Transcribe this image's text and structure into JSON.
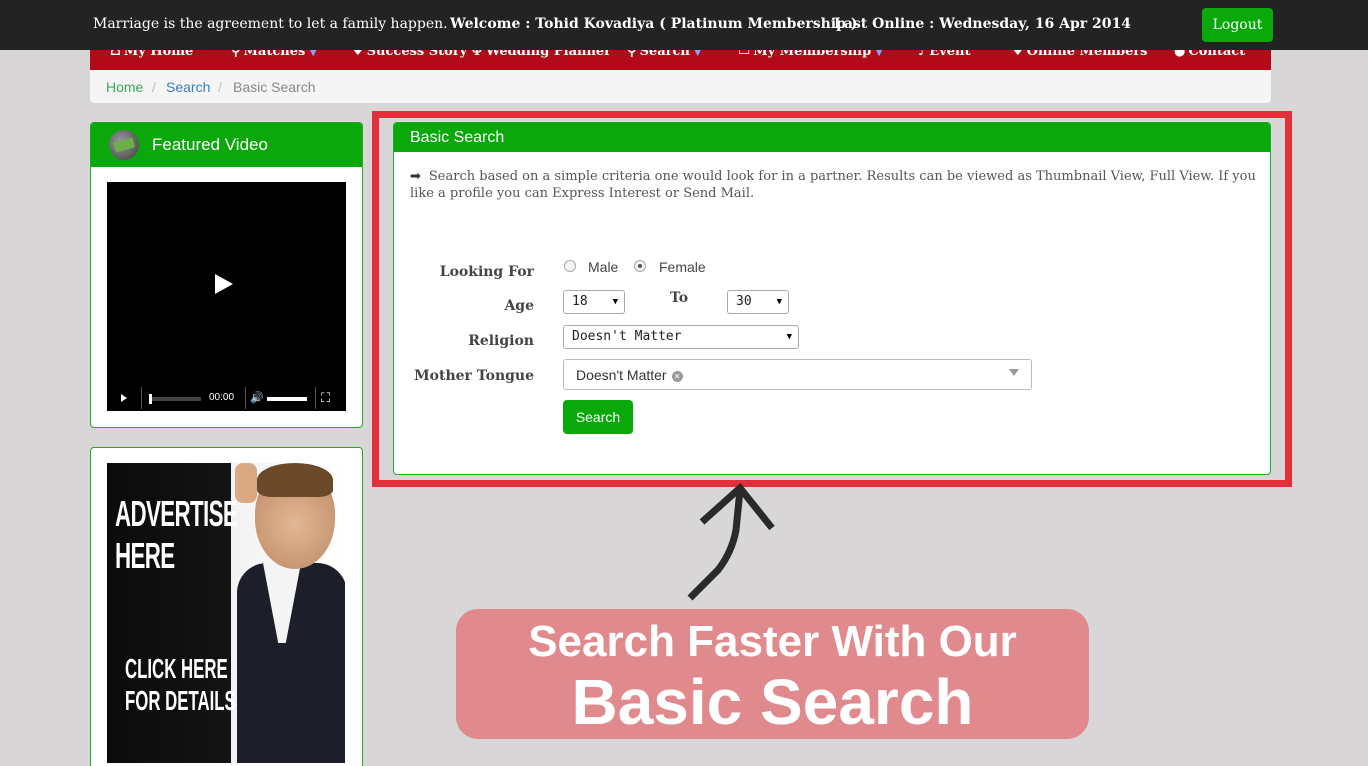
{
  "topbar": {
    "tagline": "Marriage is the agreement to let a family happen.",
    "welcome": "Welcome : Tohid Kovadiya ( Platinum Membership )",
    "last_online": "Last Online : Wednesday, 16 Apr 2014",
    "logout": "Logout"
  },
  "nav": {
    "items": [
      {
        "label": "My Home",
        "icon": "home-icon"
      },
      {
        "label": "Matches",
        "icon": "search-icon"
      },
      {
        "label": "Success Story",
        "icon": "heart-icon"
      },
      {
        "label": "Wedding Planner",
        "icon": "fork-icon"
      },
      {
        "label": "Search",
        "icon": "search-icon"
      },
      {
        "label": "My Membership",
        "icon": "card-icon"
      },
      {
        "label": "Event",
        "icon": "bell-icon"
      },
      {
        "label": "Online Members",
        "icon": "heart-icon"
      },
      {
        "label": "Contact",
        "icon": "user-icon"
      }
    ]
  },
  "breadcrumb": {
    "home": "Home",
    "search": "Search",
    "current": "Basic Search",
    "separator": "/"
  },
  "video_panel": {
    "title": "Featured Video",
    "time": "00:00"
  },
  "ad": {
    "headline_1": "ADVERTISE",
    "headline_2": "HERE",
    "cta_1": "CLICK HERE",
    "cta_2": "FOR DETAILS"
  },
  "search_panel": {
    "title": "Basic Search",
    "description": "Search based on a simple criteria one would look for in a partner. Results can be viewed as Thumbnail View, Full View. If you like a profile you can Express Interest or Send Mail.",
    "labels": {
      "looking_for": "Looking For",
      "age": "Age",
      "to": "To",
      "religion": "Religion",
      "mother_tongue": "Mother Tongue"
    },
    "gender_options": [
      "Male",
      "Female"
    ],
    "gender_selected": "Female",
    "age_from": "18",
    "age_to": "30",
    "religion": "Doesn't Matter",
    "mother_tongue": "Doesn't Matter",
    "button": "Search"
  },
  "banner": {
    "line1": "Search Faster With Our",
    "line2": "Basic Search"
  },
  "colors": {
    "green": "#0aa80a",
    "red_nav": "#b30a1a",
    "highlight": "#e1303a",
    "banner": "#e08a8e"
  }
}
